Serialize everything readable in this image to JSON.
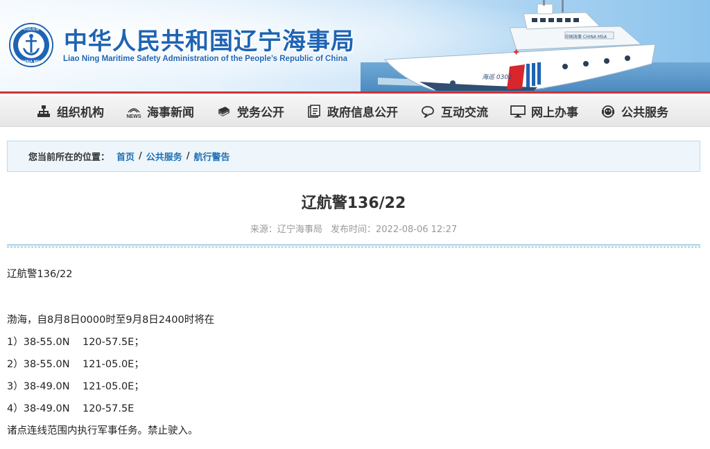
{
  "header": {
    "title_cn": "中华人民共和国辽宁海事局",
    "title_en": "Liao Ning Maritime Safety Administration of the People’s Republic of China",
    "logo_text_top": "中国海事",
    "logo_text_bottom": "CHINA MSA",
    "ship_text_side": "中国海事 CHINA MSA",
    "ship_text_hull": "海巡 0302"
  },
  "nav": {
    "items": [
      {
        "label": "组织机构",
        "icon": "org-chart-icon"
      },
      {
        "label": "海事新闻",
        "icon": "news-icon"
      },
      {
        "label": "党务公开",
        "icon": "book-icon"
      },
      {
        "label": "政府信息公开",
        "icon": "document-icon"
      },
      {
        "label": "互动交流",
        "icon": "chat-icon"
      },
      {
        "label": "网上办事",
        "icon": "monitor-icon"
      },
      {
        "label": "公共服务",
        "icon": "service-person-icon"
      }
    ]
  },
  "breadcrumb": {
    "prefix": "您当前所在的位置：",
    "items": [
      "首页",
      "公共服务",
      "航行警告"
    ],
    "separator": "/"
  },
  "article": {
    "title": "辽航警136/22",
    "source": "来源：辽宁海事局",
    "published": "发布时间：2022-08-06 12:27",
    "lines": [
      "辽航警136/22",
      "",
      "渤海，自8月8日0000时至9月8日2400时将在",
      "1）38-55.0N    120-57.5E；",
      "2）38-55.0N    121-05.0E；",
      "3）38-49.0N    121-05.0E；",
      "4）38-49.0N    120-57.5E",
      "诸点连线范围内执行军事任务。禁止驶入。"
    ]
  },
  "colors": {
    "brand_blue": "#1e64b4",
    "link_blue": "#1f6fb5",
    "accent_red": "#c7343b",
    "meta_gray": "#999999"
  }
}
